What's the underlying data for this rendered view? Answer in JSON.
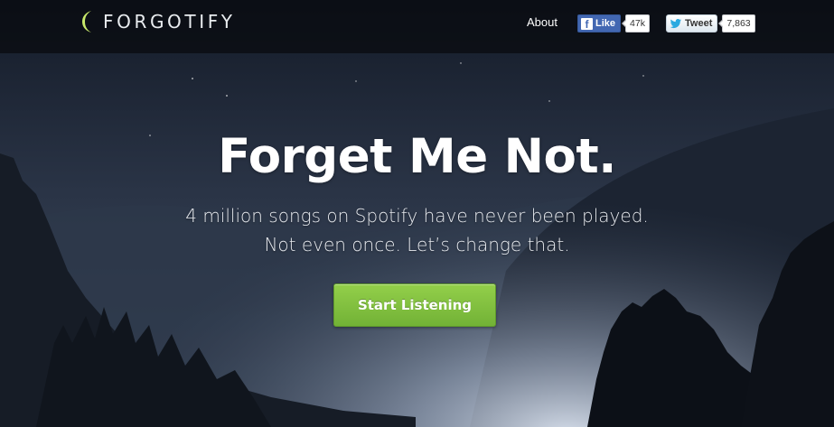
{
  "brand": {
    "name": "FORGOTIFY",
    "logo_icon": "crescent-moon-icon",
    "accent": "#c8e86a"
  },
  "nav": {
    "about_label": "About"
  },
  "social": {
    "facebook": {
      "icon": "facebook-f-icon",
      "label": "Like",
      "count": "47k"
    },
    "twitter": {
      "icon": "twitter-bird-icon",
      "label": "Tweet",
      "count": "7,863"
    }
  },
  "hero": {
    "title": "Forget Me Not.",
    "subtitle_line1": "4 million songs on Spotify have never been played.",
    "subtitle_line2": "Not even once. Let’s change that.",
    "cta_label": "Start Listening",
    "cta_color": "#7fbf3c"
  }
}
